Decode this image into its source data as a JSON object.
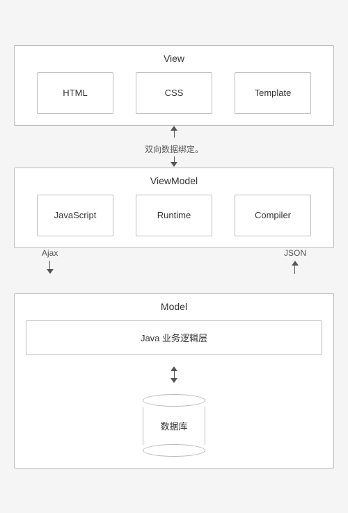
{
  "view": {
    "title": "View",
    "boxes": [
      "HTML",
      "CSS",
      "Template"
    ]
  },
  "connector_middle": {
    "label": "双向数据绑定。"
  },
  "viewmodel": {
    "title": "ViewModel",
    "boxes": [
      "JavaScript",
      "Runtime",
      "Compiler"
    ]
  },
  "connector_bottom": {
    "left_label": "Ajax",
    "right_label": "JSON"
  },
  "model": {
    "title": "Model",
    "java_layer": "Java 业务逻辑层",
    "db_label": "数据库"
  }
}
